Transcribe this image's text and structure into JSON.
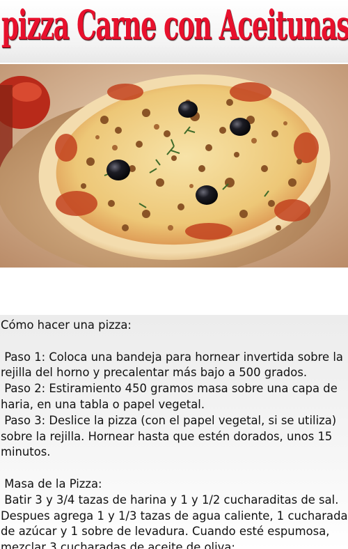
{
  "header": {
    "title": "pizza Carne con Aceitunas"
  },
  "image": {
    "subject": "pizza-with-meat-and-olives"
  },
  "recipe": {
    "intro": "Cómo hacer una pizza:",
    "step1": " Paso 1: Coloca una bandeja para hornear invertida sobre la rejilla del horno y precalentar más bajo a 500 grados.",
    "step2": " Paso 2: Estiramiento 450 gramos masa sobre una capa de haria, en una tabla o papel vegetal.",
    "step3": " Paso 3: Deslice la pizza (con el papel vegetal, si se utiliza) sobre la rejilla. Hornear hasta que estén dorados, unos 15 minutos.",
    "dough_heading": " Masa de la Pizza:",
    "dough_text": " Batir 3 y 3/4 tazas de harina y 1 y 1/2 cucharaditas de sal. Despues agrega 1 y 1/3 tazas de agua caliente, 1 cucharada de azúcar y 1 sobre de levadura. Cuando esté espumosa, mezclar 3 cucharadas de aceite de oliva;"
  },
  "colors": {
    "title": "#e8112d",
    "text": "#111111"
  }
}
